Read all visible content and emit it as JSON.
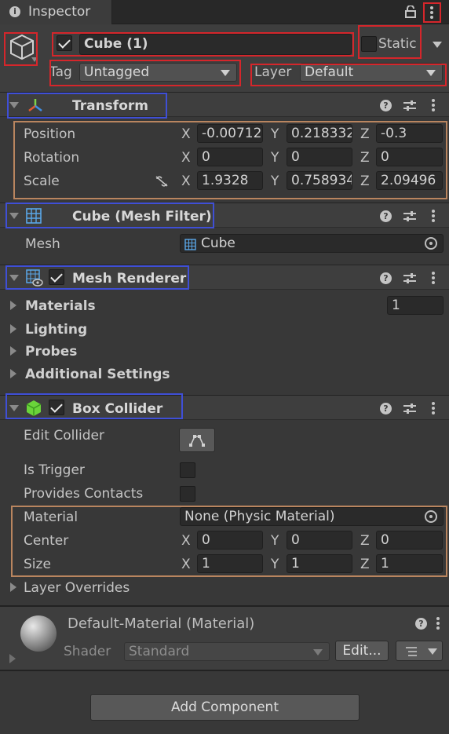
{
  "tab": {
    "title": "Inspector"
  },
  "header": {
    "active": true,
    "name": "Cube (1)",
    "static_label": "Static",
    "tag_label": "Tag",
    "tag_value": "Untagged",
    "layer_label": "Layer",
    "layer_value": "Default"
  },
  "transform": {
    "title": "Transform",
    "position_label": "Position",
    "rotation_label": "Rotation",
    "scale_label": "Scale",
    "axis_x": "X",
    "axis_y": "Y",
    "axis_z": "Z",
    "position": {
      "x": "-0.00712",
      "y": "0.218332",
      "z": "-0.3"
    },
    "rotation": {
      "x": "0",
      "y": "0",
      "z": "0"
    },
    "scale": {
      "x": "1.9328",
      "y": "0.758934",
      "z": "2.09496"
    }
  },
  "mesh_filter": {
    "title": "Cube (Mesh Filter)",
    "mesh_label": "Mesh",
    "mesh_value": "Cube"
  },
  "mesh_renderer": {
    "title": "Mesh Renderer",
    "materials_label": "Materials",
    "materials_count": "1",
    "lighting_label": "Lighting",
    "probes_label": "Probes",
    "additional_label": "Additional Settings"
  },
  "box_collider": {
    "title": "Box Collider",
    "edit_collider_label": "Edit Collider",
    "is_trigger_label": "Is Trigger",
    "provides_contacts_label": "Provides Contacts",
    "material_label": "Material",
    "material_value": "None (Physic Material)",
    "center_label": "Center",
    "size_label": "Size",
    "center": {
      "x": "0",
      "y": "0",
      "z": "0"
    },
    "size": {
      "x": "1",
      "y": "1",
      "z": "1"
    },
    "layer_overrides_label": "Layer Overrides"
  },
  "material_preview": {
    "title": "Default-Material (Material)",
    "shader_label": "Shader",
    "shader_value": "Standard",
    "edit_button": "Edit..."
  },
  "add_component": {
    "label": "Add Component"
  },
  "colors": {
    "panel_bg": "#383838",
    "header_bg": "#3e3e3e",
    "field_bg": "#2a2a2a",
    "highlight_red": "#d5262b",
    "highlight_blue": "#3f4fd6",
    "highlight_orange": "#b9855f"
  }
}
